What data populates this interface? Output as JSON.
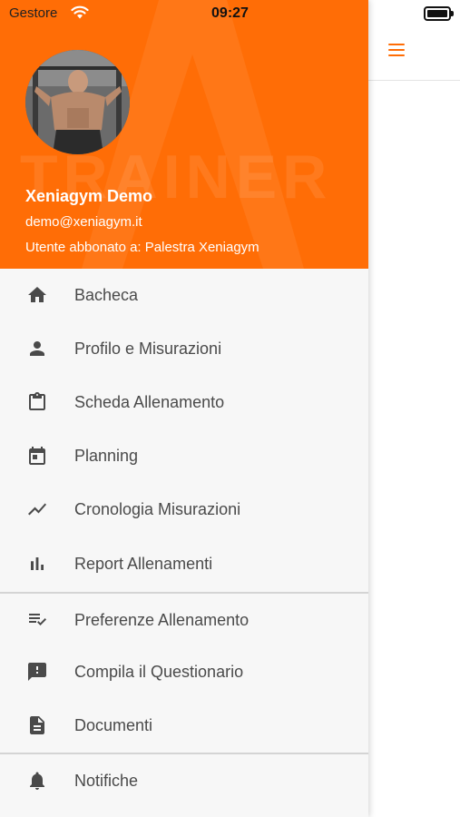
{
  "status": {
    "carrier": "Gestore",
    "time": "09:27"
  },
  "user": {
    "name": "Xeniagym Demo",
    "email": "demo@xeniagym.it",
    "subscription": "Utente abbonato a: Palestra Xeniagym"
  },
  "header": {
    "watermark": "TRAINER"
  },
  "menu": {
    "items": [
      {
        "label": "Bacheca",
        "icon": "home-icon"
      },
      {
        "label": "Profilo e Misurazioni",
        "icon": "person-icon"
      },
      {
        "label": "Scheda Allenamento",
        "icon": "clipboard-icon"
      },
      {
        "label": "Planning",
        "icon": "calendar-icon"
      },
      {
        "label": "Cronologia Misurazioni",
        "icon": "trend-line-icon"
      },
      {
        "label": "Report Allenamenti",
        "icon": "bar-chart-icon"
      },
      {
        "label": "Preferenze Allenamento",
        "icon": "checklist-icon"
      },
      {
        "label": "Compila il Questionario",
        "icon": "feedback-icon"
      },
      {
        "label": "Documenti",
        "icon": "document-icon"
      },
      {
        "label": "Notifiche",
        "icon": "bell-icon"
      }
    ]
  },
  "colors": {
    "accent": "#ff6d06",
    "text": "#4a4a4a",
    "drawer_bg": "#f7f7f7"
  }
}
